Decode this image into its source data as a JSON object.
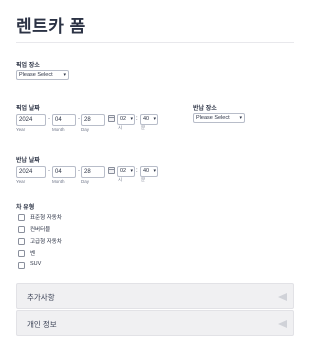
{
  "form": {
    "title": "렌트카 폼"
  },
  "pickup_location": {
    "label": "픽업 장소",
    "selected": "Please Select"
  },
  "pickup_date": {
    "label": "픽업 날짜",
    "year": "2024",
    "month": "04",
    "day": "28",
    "hour": "02",
    "minute": "40",
    "year_label": "Year",
    "month_label": "Month",
    "day_label": "Day",
    "hour_label": "시",
    "minute_label": "분"
  },
  "return_location": {
    "label": "반납 장소",
    "selected": "Please Select"
  },
  "return_date": {
    "label": "반납 날짜",
    "year": "2024",
    "month": "04",
    "day": "28",
    "hour": "02",
    "minute": "40",
    "year_label": "Year",
    "month_label": "Month",
    "day_label": "Day",
    "hour_label": "시",
    "minute_label": "분"
  },
  "car_type": {
    "label": "차 유형",
    "options": [
      "표준형 자동차",
      "컨버터블",
      "고급형 자동차",
      "벤",
      "SUV"
    ]
  },
  "sections": [
    {
      "title": "추가사항"
    },
    {
      "title": "개인 정보"
    }
  ],
  "icons": {
    "caret": "▾",
    "collapse": "triangle-left"
  }
}
